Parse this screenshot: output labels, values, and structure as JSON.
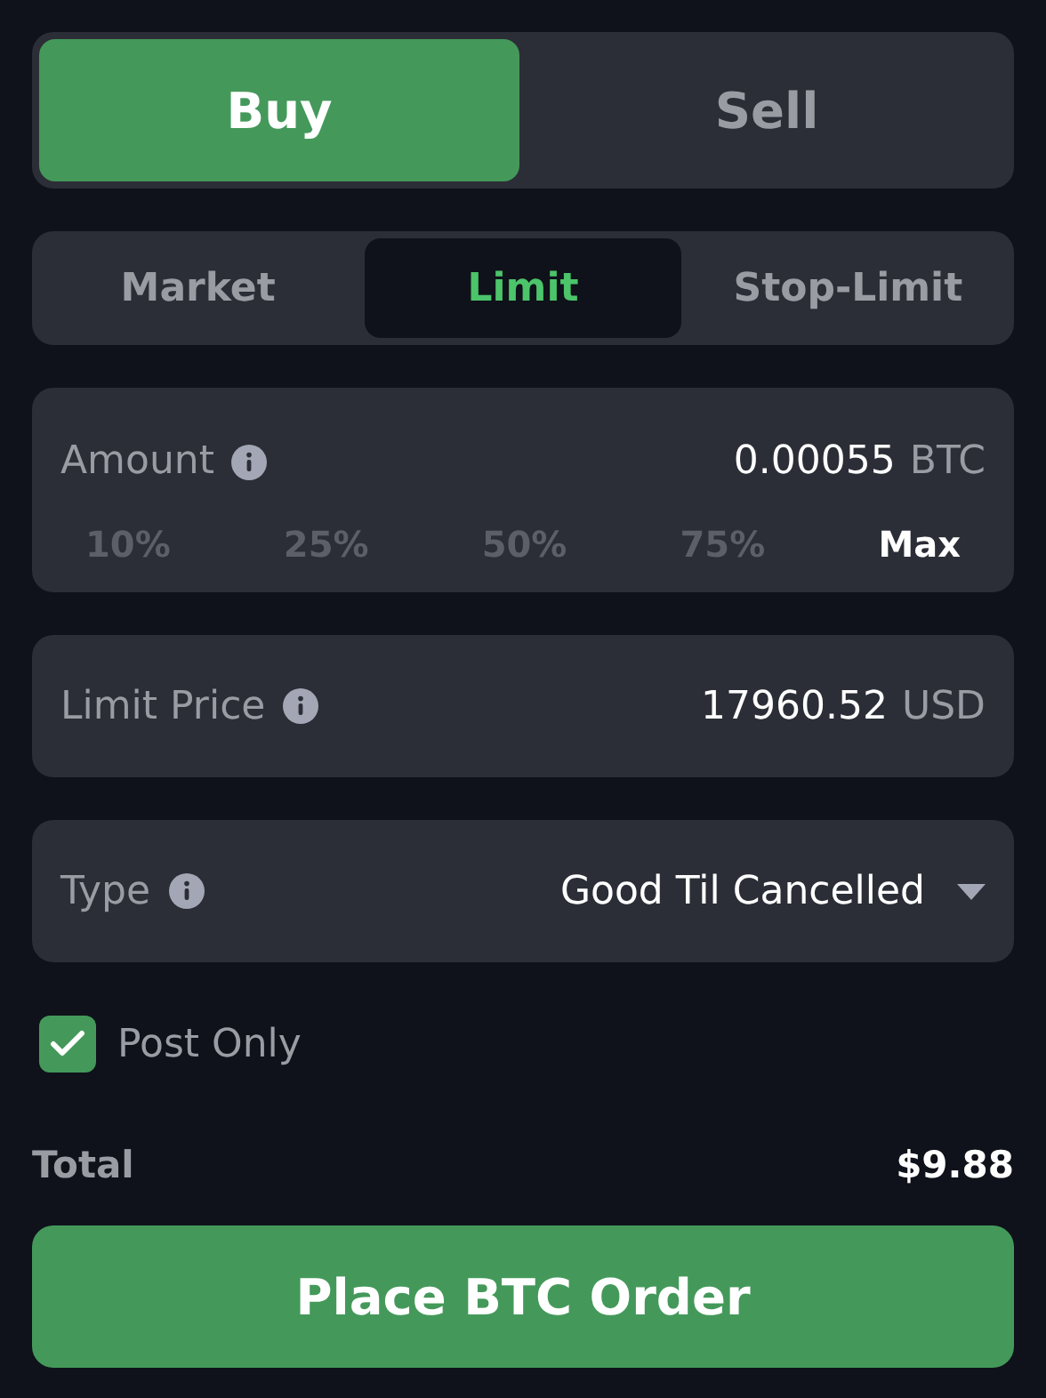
{
  "side_tabs": [
    {
      "label": "Buy",
      "selected": true
    },
    {
      "label": "Sell",
      "selected": false
    }
  ],
  "order_types": [
    {
      "label": "Market",
      "selected": false
    },
    {
      "label": "Limit",
      "selected": true
    },
    {
      "label": "Stop-Limit",
      "selected": false
    }
  ],
  "amount": {
    "label": "Amount",
    "value": "0.00055",
    "unit": "BTC",
    "presets": [
      {
        "label": "10%",
        "selected": false
      },
      {
        "label": "25%",
        "selected": false
      },
      {
        "label": "50%",
        "selected": false
      },
      {
        "label": "75%",
        "selected": false
      },
      {
        "label": "Max",
        "selected": true
      }
    ]
  },
  "limit_price": {
    "label": "Limit Price",
    "value": "17960.52",
    "unit": "USD"
  },
  "type": {
    "label": "Type",
    "value": "Good Til Cancelled"
  },
  "post_only": {
    "label": "Post Only",
    "checked": true
  },
  "total": {
    "label": "Total",
    "value": "$9.88"
  },
  "submit": "Place BTC Order"
}
